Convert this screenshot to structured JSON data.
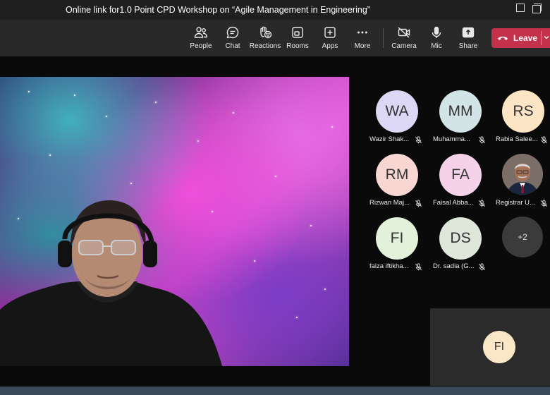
{
  "window": {
    "title": "Online link for1.0 Point CPD Workshop on “Agile Management in Engineering”"
  },
  "toolbar": {
    "items": [
      {
        "label": "People",
        "icon": "people-icon"
      },
      {
        "label": "Chat",
        "icon": "chat-icon"
      },
      {
        "label": "Reactions",
        "icon": "reactions-icon"
      },
      {
        "label": "Rooms",
        "icon": "rooms-icon"
      },
      {
        "label": "Apps",
        "icon": "apps-icon"
      },
      {
        "label": "More",
        "icon": "more-icon"
      },
      {
        "label": "Camera",
        "icon": "camera-off-icon"
      },
      {
        "label": "Mic",
        "icon": "mic-icon"
      },
      {
        "label": "Share",
        "icon": "share-icon"
      }
    ],
    "leave_label": "Leave",
    "leave_color": "#c4314b"
  },
  "participants": [
    {
      "initials": "WA",
      "name": "Wazir Shak...",
      "color": "#dcd7f5",
      "muted": true
    },
    {
      "initials": "MM",
      "name": "Muhamma...",
      "color": "#d3e4e6",
      "muted": true
    },
    {
      "initials": "RS",
      "name": "Rabia Salee...",
      "color": "#fbe5c5",
      "muted": true
    },
    {
      "initials": "RM",
      "name": "Rizwan Maj...",
      "color": "#f8d7d3",
      "muted": true
    },
    {
      "initials": "FA",
      "name": "Faisal Abba...",
      "color": "#f6d2ea",
      "muted": true
    },
    {
      "initials": "",
      "name": "Registrar U...",
      "color": "#6a5a50",
      "muted": true,
      "photo": true
    },
    {
      "initials": "FI",
      "name": "faiza iftikha...",
      "color": "#e2f1d9",
      "muted": true
    },
    {
      "initials": "DS",
      "name": "Dr. sadia (G...",
      "color": "#dfe7da",
      "muted": true
    }
  ],
  "overflow_count": "+2",
  "self_view": {
    "initials": "FI",
    "color": "#fbe7c6"
  }
}
